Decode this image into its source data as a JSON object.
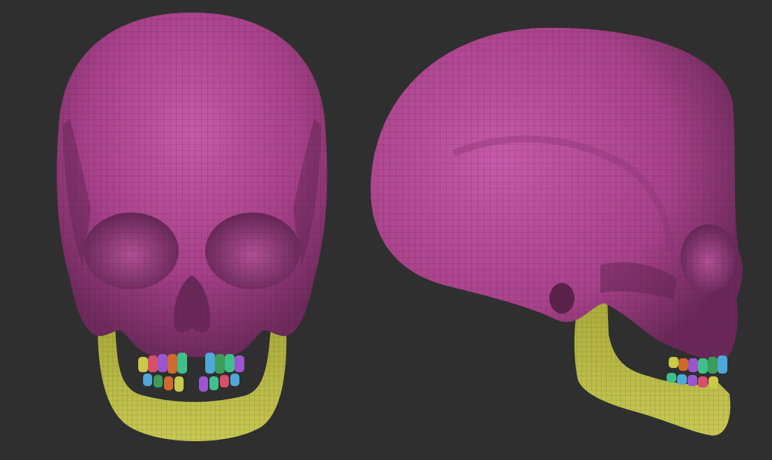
{
  "scene": {
    "background": "#2f2f2f",
    "views": [
      {
        "name": "front-view",
        "subject": "skull-front"
      },
      {
        "name": "side-view",
        "subject": "skull-side"
      }
    ],
    "polygroup_colors": {
      "cranium": "#b0458f",
      "cranium_shadow": "#6e2a5c",
      "cranium_highlight": "#c65aa8",
      "mandible": "#bfc04a",
      "mandible_shadow": "#7d7d25",
      "wireframe": "#3a1c33",
      "teeth": [
        "#3fbf8a",
        "#d06a2c",
        "#9b55d0",
        "#4fa8d8",
        "#c9c94a",
        "#3c9c5a",
        "#d84f6b"
      ]
    }
  }
}
